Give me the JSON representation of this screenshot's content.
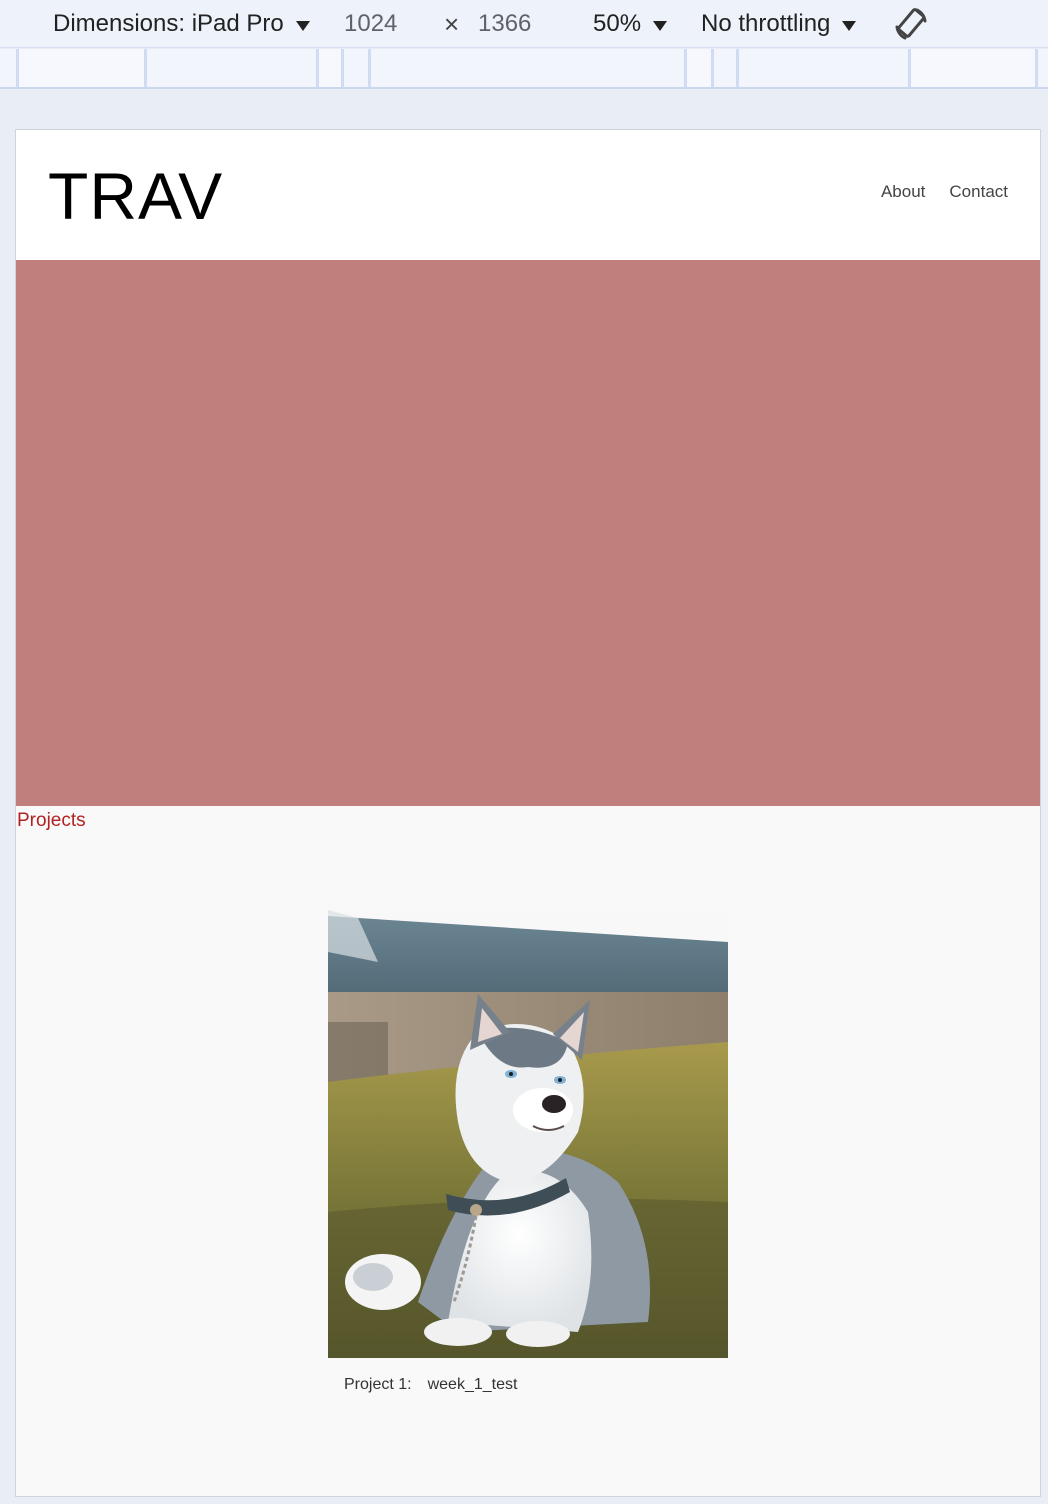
{
  "devtools": {
    "dimensions_label": "Dimensions: iPad Pro",
    "width": "1024",
    "times": "×",
    "height": "1366",
    "zoom": "50%",
    "throttling": "No throttling",
    "rotate_icon": "rotate-device-icon"
  },
  "site": {
    "logo": "TRAV",
    "nav": [
      {
        "label": "About"
      },
      {
        "label": "Contact"
      }
    ],
    "hero_color": "#c07e7c",
    "projects_heading": "Projects",
    "projects_heading_color": "#b22222",
    "projects": [
      {
        "label": "Project 1:",
        "name": "week_1_test",
        "image": "husky-dog-photo"
      }
    ]
  }
}
